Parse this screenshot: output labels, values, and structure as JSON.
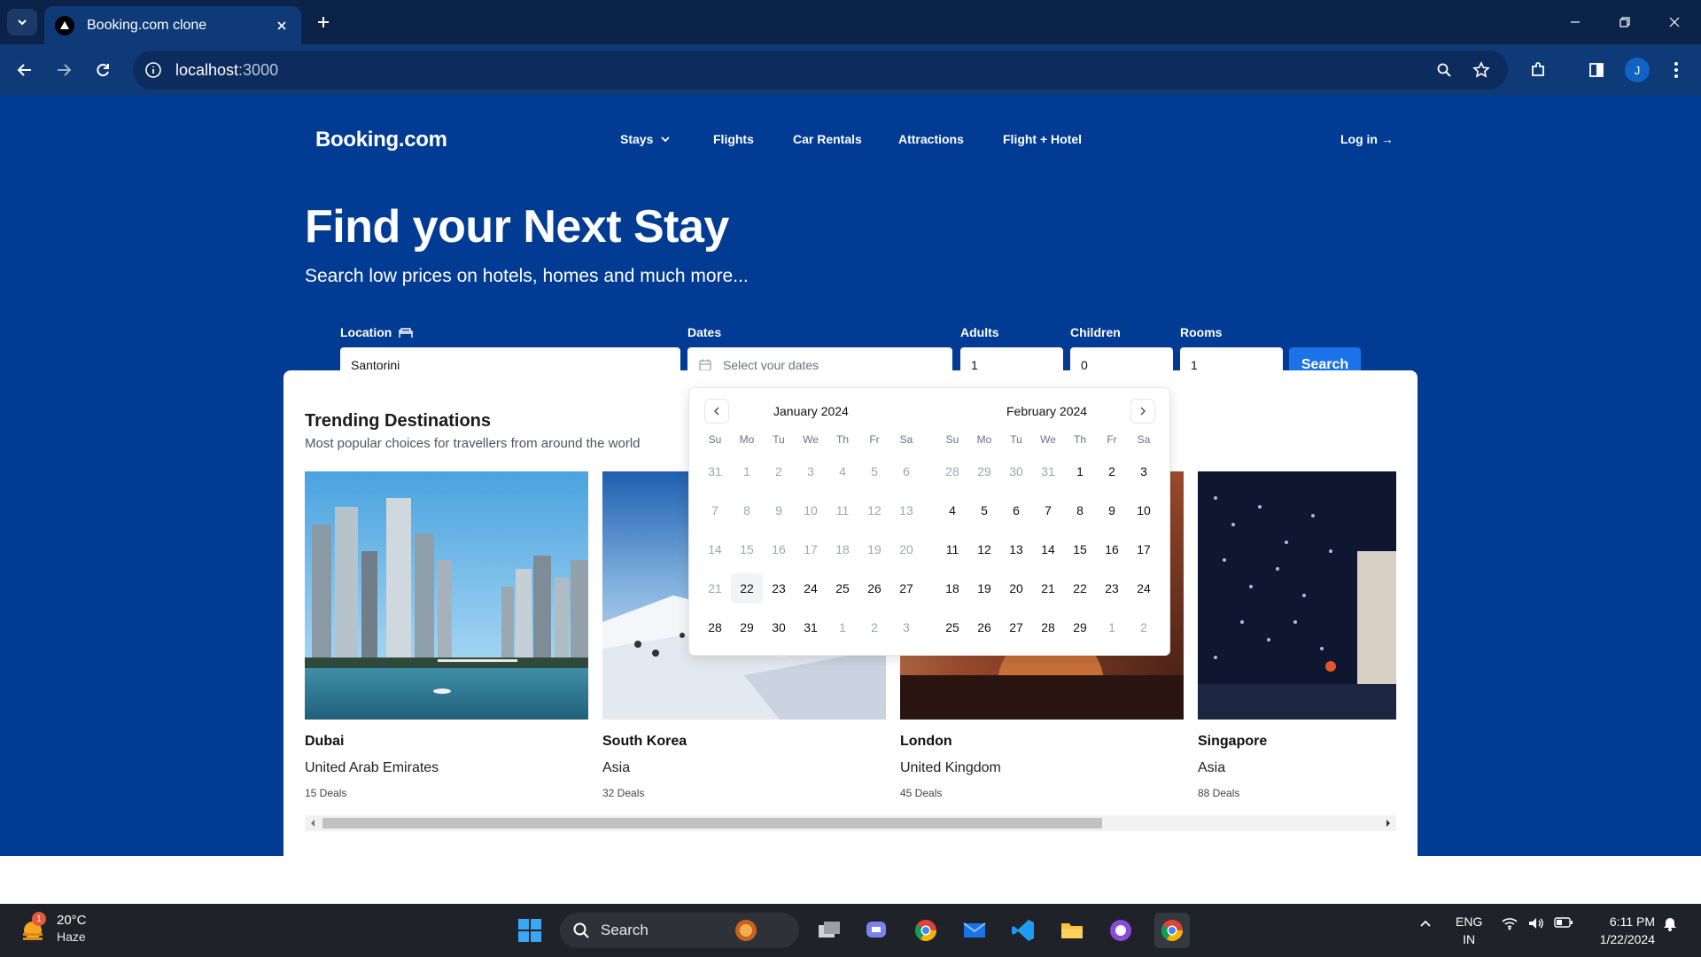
{
  "browser": {
    "tab_title": "Booking.com clone",
    "url_host": "localhost",
    "url_port": ":3000",
    "profile_initial": "J"
  },
  "site": {
    "logo": "Booking.com",
    "nav": {
      "stays": "Stays",
      "flights": "Flights",
      "car_rentals": "Car Rentals",
      "attractions": "Attractions",
      "flight_hotel": "Flight + Hotel",
      "login": "Log in →"
    },
    "hero": {
      "title": "Find your Next Stay",
      "subtitle": "Search low prices on hotels, homes and much more..."
    },
    "search": {
      "location_label": "Location",
      "location_value": "Santorini",
      "dates_label": "Dates",
      "dates_placeholder": "Select your dates",
      "adults_label": "Adults",
      "adults_value": "1",
      "children_label": "Children",
      "children_value": "0",
      "rooms_label": "Rooms",
      "rooms_value": "1",
      "search_button": "Search"
    },
    "trending": {
      "title": "Trending Destinations",
      "subtitle": "Most popular choices for travellers from around the world",
      "destinations": [
        {
          "name": "Dubai",
          "region": "United Arab Emirates",
          "deals": "15 Deals"
        },
        {
          "name": "South Korea",
          "region": "Asia",
          "deals": "32 Deals"
        },
        {
          "name": "London",
          "region": "United Kingdom",
          "deals": "45 Deals"
        },
        {
          "name": "Singapore",
          "region": "Asia",
          "deals": "88 Deals"
        }
      ]
    },
    "calendar": {
      "weekdays": [
        "Su",
        "Mo",
        "Tu",
        "We",
        "Th",
        "Fr",
        "Sa"
      ],
      "months": [
        {
          "title": "January 2024",
          "weeks": [
            [
              "31",
              "1",
              "2",
              "3",
              "4",
              "5",
              "6"
            ],
            [
              "7",
              "8",
              "9",
              "10",
              "11",
              "12",
              "13"
            ],
            [
              "14",
              "15",
              "16",
              "17",
              "18",
              "19",
              "20"
            ],
            [
              "21",
              "22",
              "23",
              "24",
              "25",
              "26",
              "27"
            ],
            [
              "28",
              "29",
              "30",
              "31",
              "1",
              "2",
              "3"
            ]
          ]
        },
        {
          "title": "February 2024",
          "weeks": [
            [
              "28",
              "29",
              "30",
              "31",
              "1",
              "2",
              "3"
            ],
            [
              "4",
              "5",
              "6",
              "7",
              "8",
              "9",
              "10"
            ],
            [
              "11",
              "12",
              "13",
              "14",
              "15",
              "16",
              "17"
            ],
            [
              "18",
              "19",
              "20",
              "21",
              "22",
              "23",
              "24"
            ],
            [
              "25",
              "26",
              "27",
              "28",
              "29",
              "1",
              "2"
            ]
          ]
        }
      ],
      "today": "22"
    }
  },
  "taskbar": {
    "weather_temp": "20°C",
    "weather_condition": "Haze",
    "weather_badge": "1",
    "search_placeholder": "Search",
    "lang_line1": "ENG",
    "lang_line2": "IN",
    "time": "6:11 PM",
    "date": "1/22/2024"
  },
  "colors": {
    "brand_blue": "#013b94",
    "search_button": "#1a73e8",
    "chrome_dark": "#0b2348",
    "chrome_toolbar": "#0e3a78"
  }
}
